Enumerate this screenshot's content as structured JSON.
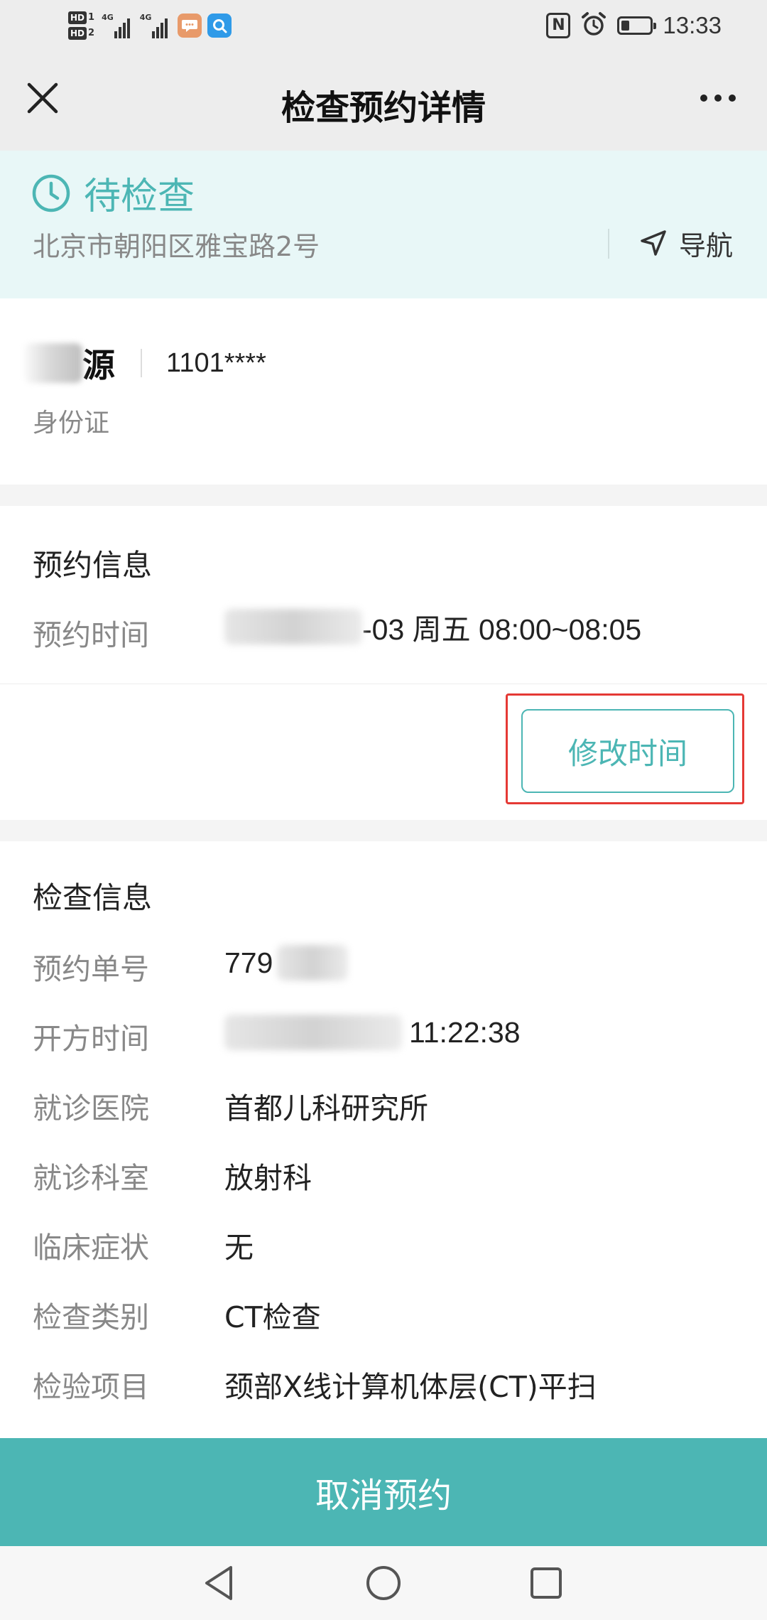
{
  "status_bar": {
    "time": "13:33",
    "sim1_label": "HD",
    "sim1_num": "1",
    "sim2_label": "HD",
    "sim2_num": "2",
    "network1": "4G",
    "network2": "4G",
    "nfc_label": "N",
    "battery_level": 0.3
  },
  "header": {
    "title": "检查预约详情",
    "close_icon": "close-icon",
    "more_icon": "more-dots-icon"
  },
  "banner": {
    "status_text": "待检查",
    "status_icon": "clock-icon",
    "address": "北京市朝阳区雅宝路2号",
    "nav_label": "导航",
    "nav_icon": "navigation-arrow-icon"
  },
  "patient": {
    "name_visible": "源",
    "id_number": "1101****",
    "id_type": "身份证"
  },
  "appointment": {
    "section_title": "预约信息",
    "time_label": "预约时间",
    "time_value": "-03 周五 08:00~08:05",
    "modify_button": "修改时间"
  },
  "exam": {
    "section_title": "检查信息",
    "rows": [
      {
        "label": "预约单号",
        "value": "779"
      },
      {
        "label": "开方时间",
        "value": "11:22:38"
      },
      {
        "label": "就诊医院",
        "value": "首都儿科研究所"
      },
      {
        "label": "就诊科室",
        "value": "放射科"
      },
      {
        "label": "临床症状",
        "value": "无"
      },
      {
        "label": "检查类别",
        "value": "CT检查"
      },
      {
        "label": "检验项目",
        "value": "颈部X线计算机体层(CT)平扫"
      }
    ]
  },
  "footer": {
    "cancel_button": "取消预约"
  },
  "colors": {
    "accent": "#4cb6b4",
    "banner_bg": "#e8f7f7",
    "highlight": "#e53935"
  }
}
